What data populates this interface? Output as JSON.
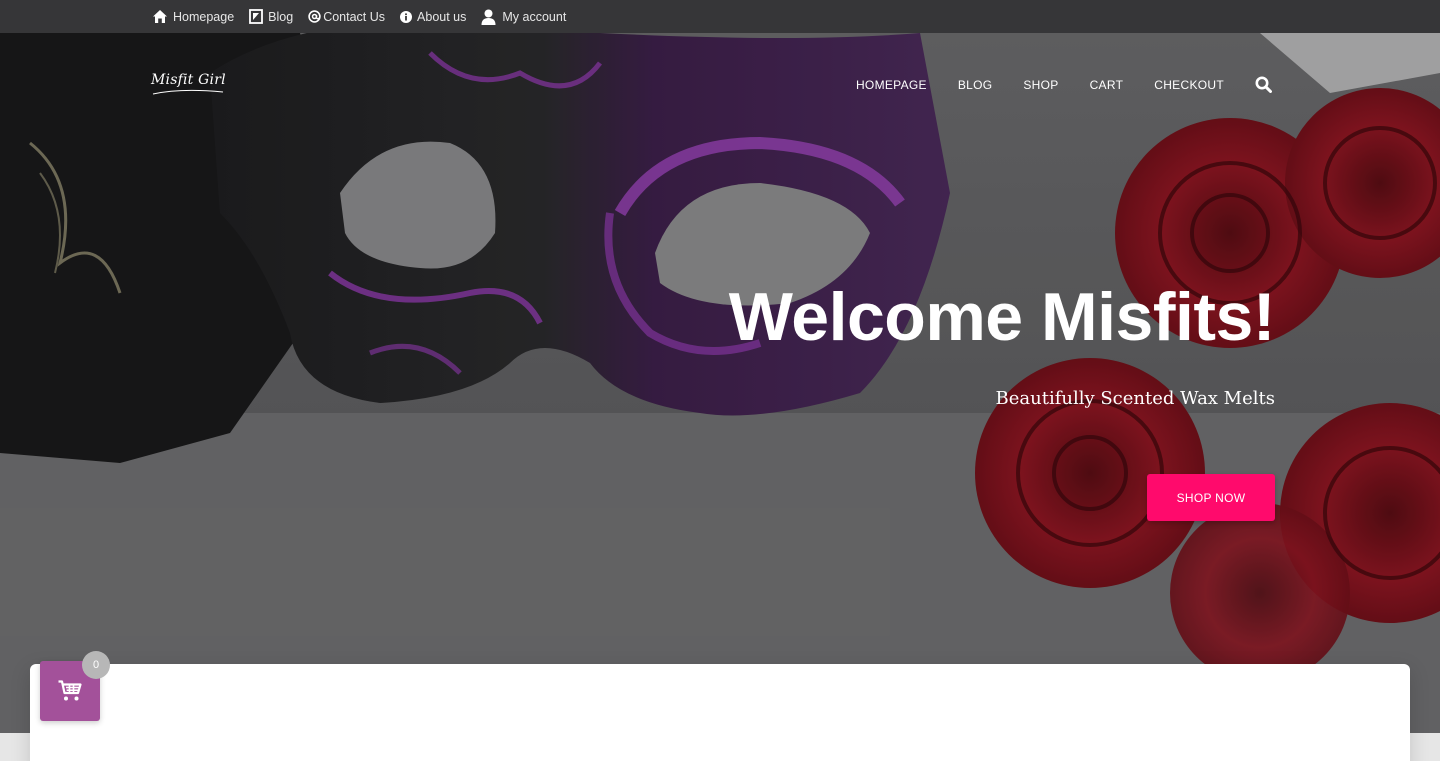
{
  "topbar": {
    "items": [
      {
        "label": "Homepage",
        "icon": "home-icon"
      },
      {
        "label": "Blog",
        "icon": "blog-icon"
      },
      {
        "label": "Contact Us",
        "icon": "at-icon"
      },
      {
        "label": "About us",
        "icon": "info-icon"
      },
      {
        "label": "My account",
        "icon": "user-icon"
      }
    ]
  },
  "header": {
    "logo_text": "Misfit Girl",
    "nav": [
      "HOMEPAGE",
      "BLOG",
      "SHOP",
      "CART",
      "CHECKOUT"
    ],
    "search_icon": "search-icon"
  },
  "hero": {
    "title": "Welcome Misfits!",
    "subtitle": "Beautifully Scented Wax Melts",
    "cta_label": "SHOP NOW"
  },
  "cart": {
    "count": "0",
    "icon": "cart-icon"
  },
  "colors": {
    "topbar_bg": "#363638",
    "cta": "#ff0a6c",
    "cart_fab": "#a3519a",
    "mask_purple": "#7b2a9a",
    "rose_red": "#8e1622"
  }
}
